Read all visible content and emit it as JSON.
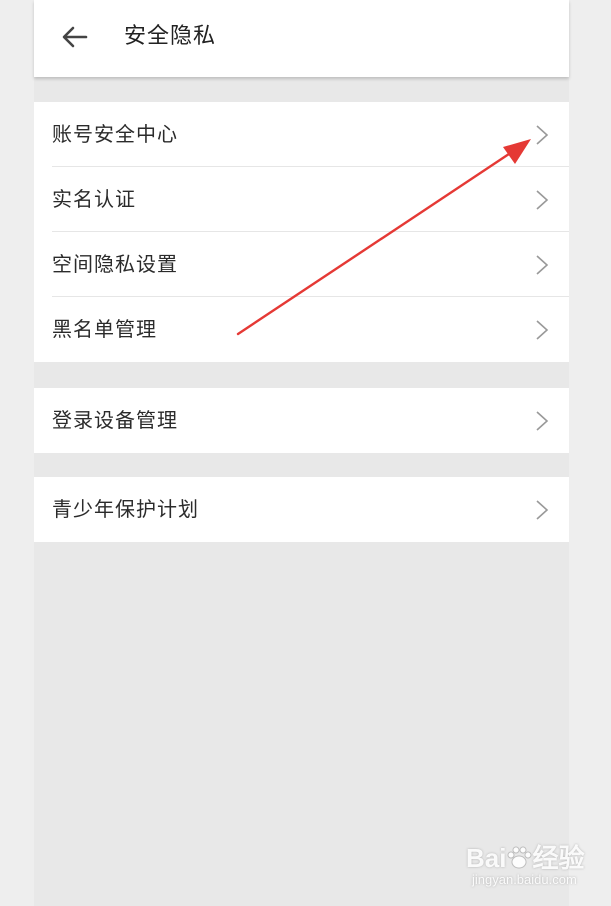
{
  "header": {
    "title": "安全隐私",
    "back_icon": "arrow-left-icon"
  },
  "groups": [
    {
      "items": [
        {
          "label": "账号安全中心"
        },
        {
          "label": "实名认证"
        },
        {
          "label": "空间隐私设置"
        },
        {
          "label": "黑名单管理"
        }
      ]
    },
    {
      "items": [
        {
          "label": "登录设备管理"
        }
      ]
    },
    {
      "items": [
        {
          "label": "青少年保护计划"
        }
      ]
    }
  ],
  "annotation": {
    "color": "#e53935"
  },
  "watermark": {
    "logo": "Baidu经验",
    "url": "jingyan.baidu.com"
  }
}
